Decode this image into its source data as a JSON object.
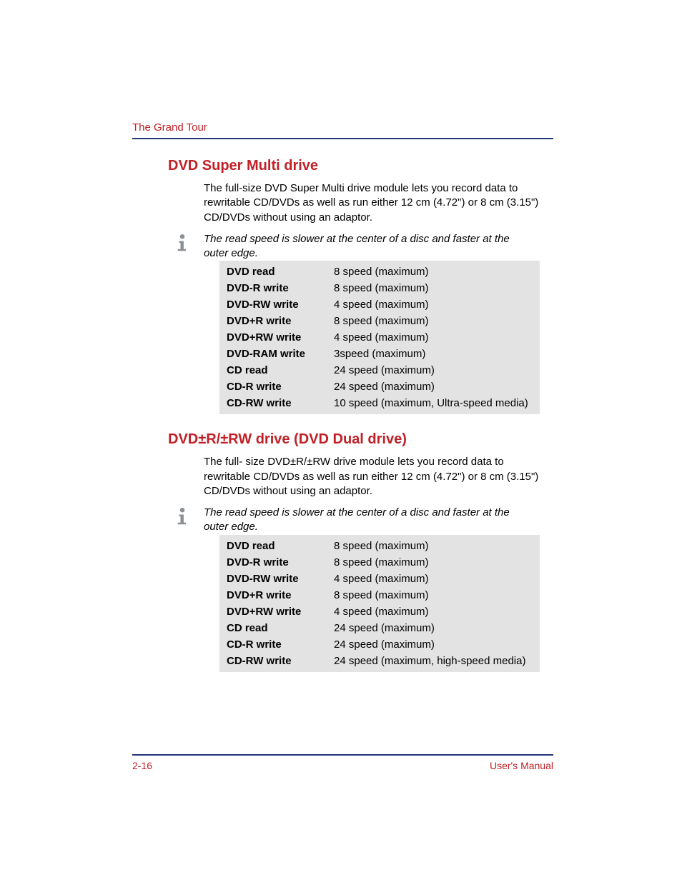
{
  "header": {
    "running_head": "The Grand Tour"
  },
  "sections": {
    "multi": {
      "title": "DVD Super Multi drive",
      "body": "The full-size DVD Super Multi drive module lets you record data to rewritable CD/DVDs as well as run either 12 cm (4.72\") or 8 cm (3.15\") CD/DVDs without using an adaptor.",
      "note": "The read speed is slower at the center of a disc and faster at the outer edge.",
      "rows": [
        {
          "label": "DVD read",
          "value": "8 speed (maximum)"
        },
        {
          "label": "DVD-R write",
          "value": "8 speed (maximum)"
        },
        {
          "label": "DVD-RW write",
          "value": "4 speed (maximum)"
        },
        {
          "label": "DVD+R write",
          "value": "8 speed (maximum)"
        },
        {
          "label": "DVD+RW write",
          "value": "4 speed (maximum)"
        },
        {
          "label": "DVD-RAM write",
          "value": "3speed (maximum)"
        },
        {
          "label": "CD read",
          "value": "24 speed (maximum)"
        },
        {
          "label": "CD-R write",
          "value": "24 speed (maximum)"
        },
        {
          "label": "CD-RW write",
          "value": "10 speed (maximum, Ultra-speed media)"
        }
      ]
    },
    "dual": {
      "title": "DVD±R/±RW drive (DVD Dual drive)",
      "body": "The full- size DVD±R/±RW drive module lets you record data to rewritable CD/DVDs as well as run either 12 cm (4.72\") or 8 cm (3.15\") CD/DVDs without using an adaptor.",
      "note": "The read speed is slower at the center of a disc and faster at the outer edge.",
      "rows": [
        {
          "label": "DVD read",
          "value": "8 speed (maximum)"
        },
        {
          "label": "DVD-R write",
          "value": "8 speed (maximum)"
        },
        {
          "label": "DVD-RW write",
          "value": "4 speed (maximum)"
        },
        {
          "label": "DVD+R write",
          "value": "8 speed (maximum)"
        },
        {
          "label": "DVD+RW write",
          "value": "4 speed (maximum)"
        },
        {
          "label": "CD read",
          "value": "24 speed (maximum)"
        },
        {
          "label": "CD-R write",
          "value": "24 speed (maximum)"
        },
        {
          "label": "CD-RW write",
          "value": "24 speed (maximum, high-speed media)"
        }
      ]
    }
  },
  "footer": {
    "page_num": "2-16",
    "doc_title": "User's Manual"
  }
}
